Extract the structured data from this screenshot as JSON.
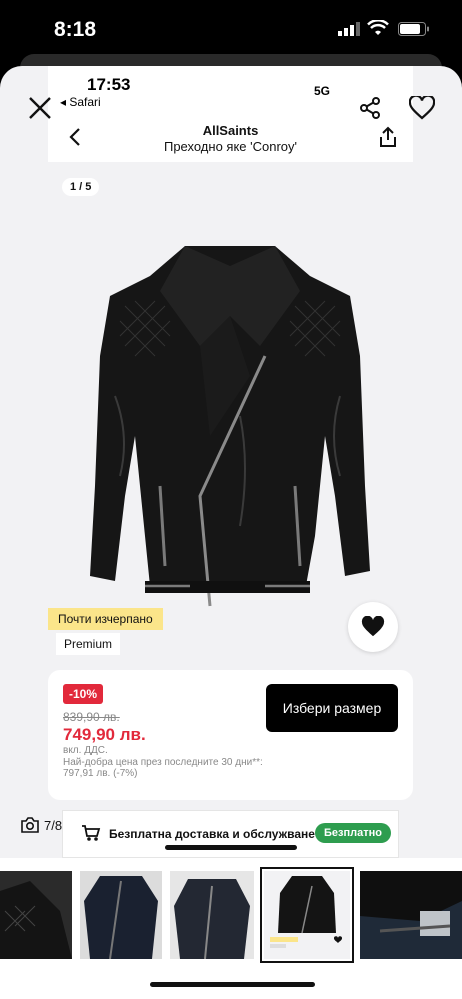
{
  "status_bar": {
    "time": "8:18"
  },
  "inner_status": {
    "time": "17:53",
    "back_app": "◂ Safari",
    "network": "5G"
  },
  "header": {
    "brand": "AllSaints",
    "product_name": "Преходно яке 'Conroy'"
  },
  "gallery": {
    "counter": "1 / 5"
  },
  "badges": {
    "low_stock": "Почти изчерпано",
    "tier": "Premium"
  },
  "price": {
    "discount": "-10%",
    "old_price": "839,90 лв.",
    "new_price": "749,90 лв.",
    "vat": "вкл. ДДС.",
    "best_price_line1": "Най-добра цена през последните 30 дни**:",
    "best_price_line2": "797,91 лв. (-7%)"
  },
  "size_button": "Избери размер",
  "shipping": {
    "text": "Безплатна доставка и обслужване",
    "badge": "Безплатно"
  },
  "photo_counter": "7/8",
  "colors": {
    "accent_red": "#e2293b",
    "green": "#2e9d4f",
    "yellow": "#fbe58a"
  },
  "icons": [
    "close-icon",
    "share-icon",
    "heart-icon",
    "back-arrow-icon",
    "upload-icon",
    "truck-icon",
    "camera-icon"
  ]
}
